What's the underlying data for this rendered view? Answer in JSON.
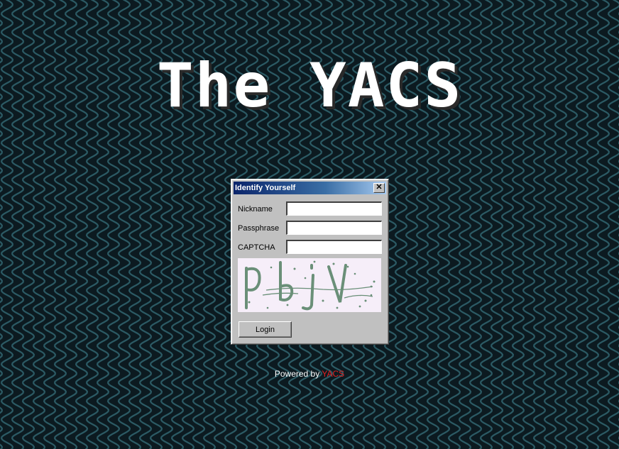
{
  "page": {
    "title": "The YACS"
  },
  "colors": {
    "background": "#0c1a20",
    "wave": "#2c5a64",
    "link": "#e02020"
  },
  "dialog": {
    "title": "Identify Yourself",
    "close_icon": "close-icon",
    "fields": {
      "nickname": {
        "label": "Nickname",
        "value": ""
      },
      "passphrase": {
        "label": "Passphrase",
        "value": ""
      },
      "captcha": {
        "label": "CAPTCHA",
        "value": ""
      }
    },
    "captcha_image": {
      "text": "pbjv"
    },
    "login_button": "Login"
  },
  "footer": {
    "prefix": "Powered by",
    "link_text": "YACS"
  }
}
